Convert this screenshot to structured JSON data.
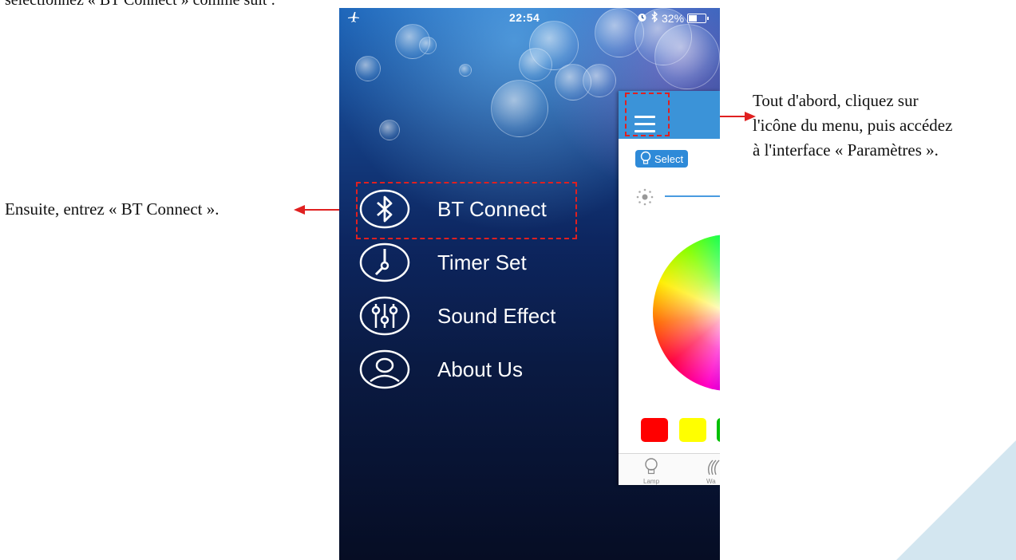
{
  "doc": {
    "top_cut_text": "sélectionnez « BT Connect » comme suit :",
    "annotation_left": "Ensuite, entrez « BT Connect ».",
    "annotation_right_lines": [
      "Tout d'abord, cliquez sur",
      "l'icône du menu, puis accédez",
      "à l'interface « Paramètres »."
    ],
    "annotation_color": "#e02020"
  },
  "status_bar": {
    "time": "22:54",
    "battery": "32%",
    "airplane_icon": "airplane-icon",
    "alarm_icon": "alarm-icon",
    "bluetooth_icon": "bluetooth-icon"
  },
  "menu": {
    "items": [
      {
        "label": "BT Connect",
        "icon": "bluetooth-icon"
      },
      {
        "label": "Timer Set",
        "icon": "timer-icon"
      },
      {
        "label": "Sound Effect",
        "icon": "equalizer-icon"
      },
      {
        "label": "About Us",
        "icon": "user-icon"
      }
    ]
  },
  "panel": {
    "select_label": "Select",
    "header_color": "#3b93d8",
    "swatches": [
      "#ff0000",
      "#ffff00",
      "#00c000"
    ],
    "tabs": [
      {
        "label": "Lamp",
        "icon": "lamp-icon"
      },
      {
        "label": "Wa",
        "icon": "wave-icon"
      }
    ]
  }
}
